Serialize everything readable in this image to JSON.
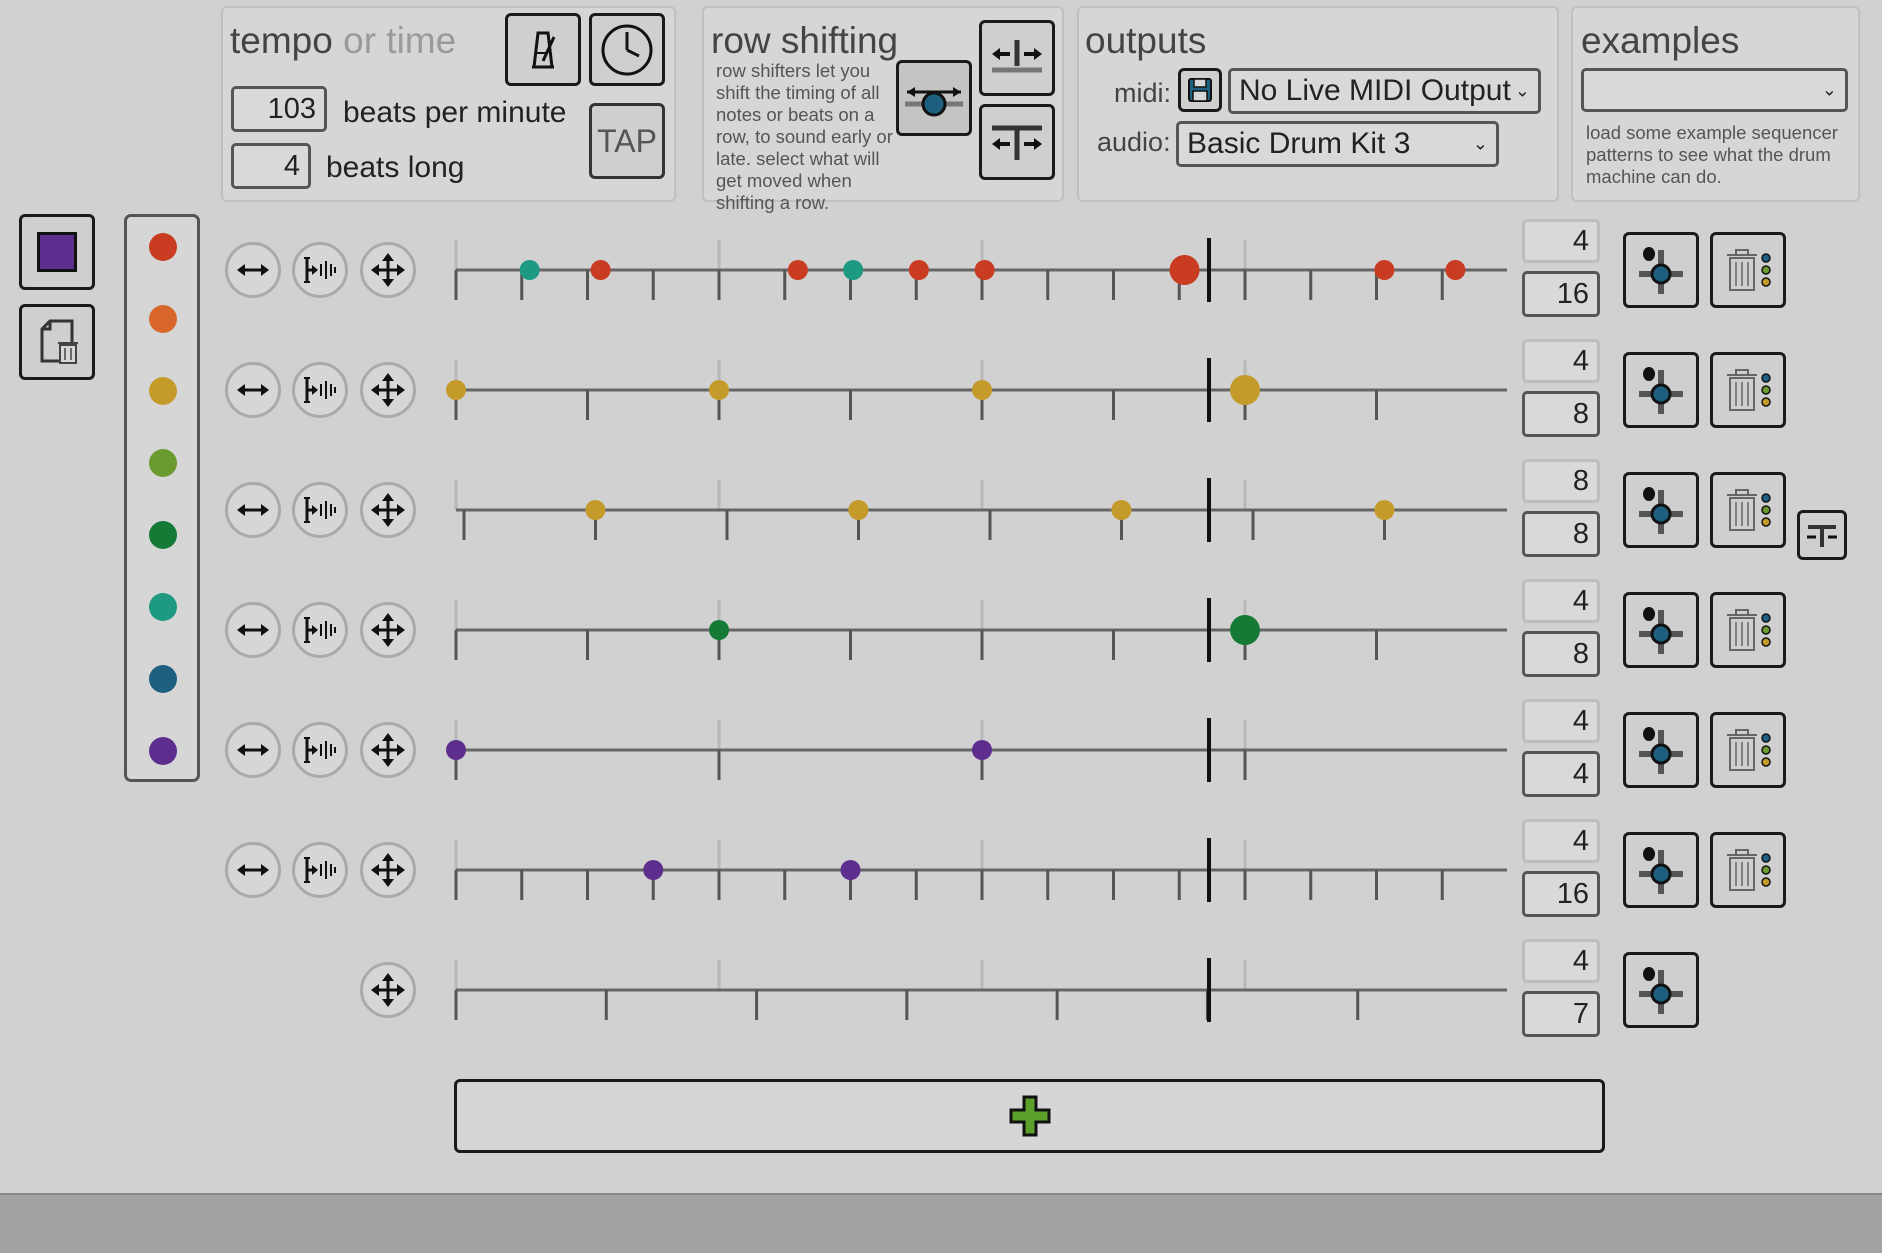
{
  "tempo": {
    "title": "tempo",
    "title_muted": "or time",
    "bpm_value": "103",
    "bpm_label": "beats per minute",
    "beats_value": "4",
    "beats_label": "beats long",
    "tap_label": "TAP"
  },
  "row_shifting": {
    "title": "row shifting",
    "description": "row shifters let you shift the timing of all notes or beats on a row, to sound early or late. select what will get moved when shifting a row."
  },
  "outputs": {
    "title": "outputs",
    "midi_label": "midi:",
    "midi_value": "No Live MIDI Output",
    "audio_label": "audio:",
    "audio_value": "Basic Drum Kit 3"
  },
  "examples": {
    "title": "examples",
    "select_value": "",
    "description": "load some example sequencer patterns to see what the drum machine can do."
  },
  "colors": {
    "palette": [
      "#c93c22",
      "#d9662a",
      "#c49a2a",
      "#6b9a2e",
      "#147a35",
      "#1e9a82",
      "#1e6080",
      "#5e2e8e"
    ],
    "selected_instrument": "#5e2e8e",
    "add_button": "#5aa02a"
  },
  "rows": [
    {
      "top": "4",
      "bottom": "16",
      "notes": [
        {
          "t": 0.07,
          "c": 5
        },
        {
          "t": 0.1375,
          "c": 0
        },
        {
          "t": 0.325,
          "c": 0
        },
        {
          "t": 0.3775,
          "c": 5
        },
        {
          "t": 0.44,
          "c": 0
        },
        {
          "t": 0.5025,
          "c": 0
        },
        {
          "t": 0.6925,
          "c": 0,
          "big": true
        },
        {
          "t": 0.8825,
          "c": 0
        },
        {
          "t": 0.95,
          "c": 0
        }
      ]
    },
    {
      "top": "4",
      "bottom": "8",
      "notes": [
        {
          "t": 0,
          "c": 2
        },
        {
          "t": 0.25,
          "c": 2
        },
        {
          "t": 0.5,
          "c": 2
        },
        {
          "t": 0.75,
          "c": 2,
          "big": true
        }
      ]
    },
    {
      "top": "8",
      "bottom": "8",
      "notes": [
        {
          "t": 0.1325,
          "c": 2
        },
        {
          "t": 0.3825,
          "c": 2
        },
        {
          "t": 0.6325,
          "c": 2
        },
        {
          "t": 0.8825,
          "c": 2
        }
      ]
    },
    {
      "top": "4",
      "bottom": "8",
      "notes": [
        {
          "t": 0.25,
          "c": 4
        },
        {
          "t": 0.75,
          "c": 4,
          "big": true
        }
      ]
    },
    {
      "top": "4",
      "bottom": "4",
      "notes": [
        {
          "t": 0,
          "c": 7
        },
        {
          "t": 0.5,
          "c": 7
        }
      ]
    },
    {
      "top": "4",
      "bottom": "16",
      "notes": [
        {
          "t": 0.1875,
          "c": 7
        },
        {
          "t": 0.375,
          "c": 7
        }
      ]
    },
    {
      "top": "4",
      "bottom": "7",
      "notes": []
    }
  ],
  "icons": {
    "metronome": "metronome-icon",
    "clock": "clock-icon",
    "shift_both": "shift-both-icon",
    "shift_notes": "shift-notes-icon",
    "shift_beats": "shift-beats-icon",
    "save": "floppy-disk-icon",
    "stop": "stop-icon",
    "clear": "clear-pattern-icon",
    "stretch": "stretch-row-icon",
    "volume": "volume-row-icon",
    "move": "move-row-icon",
    "mixer": "mixer-slider-icon",
    "trash": "trash-icon",
    "add": "plus-icon"
  }
}
